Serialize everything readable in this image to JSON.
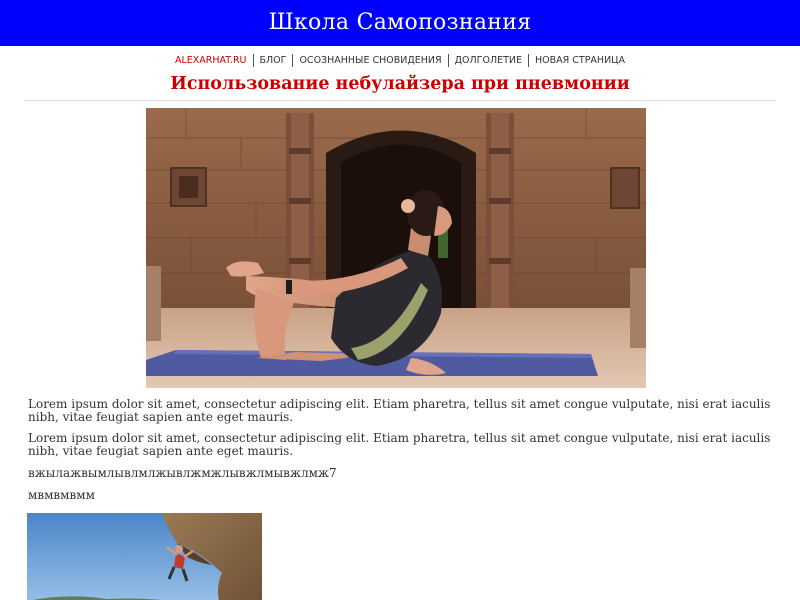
{
  "header": {
    "title": "Школа Самопознания",
    "background_color": "#0000ff"
  },
  "nav": {
    "items": [
      {
        "label": "ALEXARHAT.RU"
      },
      {
        "label": "БЛОГ"
      },
      {
        "label": "ОСОЗНАННЫЕ СНОВИДЕНИЯ"
      },
      {
        "label": "ДОЛГОЛЕТИЕ"
      },
      {
        "label": "НОВАЯ СТРАНИЦА"
      }
    ]
  },
  "article": {
    "title": "Использование небулайзера при пневмонии",
    "title_color": "#cc0000",
    "hero_image": {
      "icon": "yoga-photo"
    },
    "paragraphs": [
      "Lorem ipsum dolor sit amet, consectetur adipiscing elit. Etiam pharetra, tellus sit amet congue vulputate, nisi erat iaculis nibh, vitae feugiat sapien ante eget mauris.",
      "Lorem ipsum dolor sit amet, consectetur adipiscing elit. Etiam pharetra, tellus sit amet congue vulputate, nisi erat iaculis nibh, vitae feugiat sapien ante eget mauris.",
      "вжылажвымлывлмлжывлжмжлывжлмывжлмж7",
      "мвмвмвмм"
    ],
    "second_image": {
      "icon": "rock-climbing-photo"
    }
  }
}
